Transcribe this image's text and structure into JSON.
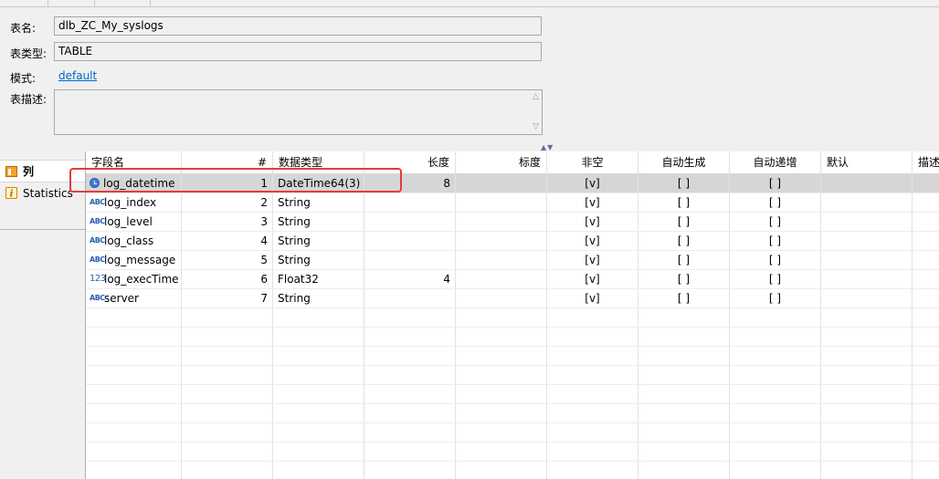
{
  "form": {
    "table_name_label": "表名:",
    "table_name_value": "dlb_ZC_My_syslogs",
    "table_type_label": "表类型:",
    "table_type_value": "TABLE",
    "schema_label": "模式:",
    "schema_value": "default",
    "description_label": "表描述:",
    "description_value": ""
  },
  "side_tabs": [
    {
      "label": "列",
      "icon": "columns-icon",
      "active": true
    },
    {
      "label": "Statistics",
      "icon": "info-icon",
      "active": false
    }
  ],
  "columns_table": {
    "headers": [
      "字段名",
      "#",
      "数据类型",
      "长度",
      "标度",
      "非空",
      "自动生成",
      "自动递增",
      "默认",
      "描述"
    ],
    "rows": [
      {
        "name": "log_datetime",
        "icon": "datetime-icon",
        "index": "1",
        "type": "DateTime64(3)",
        "length": "8",
        "scale": "",
        "not_null": "[v]",
        "auto_gen": "[ ]",
        "auto_inc": "[ ]",
        "default": "",
        "description": "",
        "selected": true
      },
      {
        "name": "log_index",
        "icon": "string-icon",
        "index": "2",
        "type": "String",
        "length": "",
        "scale": "",
        "not_null": "[v]",
        "auto_gen": "[ ]",
        "auto_inc": "[ ]",
        "default": "",
        "description": ""
      },
      {
        "name": "log_level",
        "icon": "string-icon",
        "index": "3",
        "type": "String",
        "length": "",
        "scale": "",
        "not_null": "[v]",
        "auto_gen": "[ ]",
        "auto_inc": "[ ]",
        "default": "",
        "description": ""
      },
      {
        "name": "log_class",
        "icon": "string-icon",
        "index": "4",
        "type": "String",
        "length": "",
        "scale": "",
        "not_null": "[v]",
        "auto_gen": "[ ]",
        "auto_inc": "[ ]",
        "default": "",
        "description": ""
      },
      {
        "name": "log_message",
        "icon": "string-icon",
        "index": "5",
        "type": "String",
        "length": "",
        "scale": "",
        "not_null": "[v]",
        "auto_gen": "[ ]",
        "auto_inc": "[ ]",
        "default": "",
        "description": ""
      },
      {
        "name": "log_execTime",
        "icon": "number-icon",
        "index": "6",
        "type": "Float32",
        "length": "4",
        "scale": "",
        "not_null": "[v]",
        "auto_gen": "[ ]",
        "auto_inc": "[ ]",
        "default": "",
        "description": ""
      },
      {
        "name": "server",
        "icon": "string-icon",
        "index": "7",
        "type": "String",
        "length": "",
        "scale": "",
        "not_null": "[v]",
        "auto_gen": "[ ]",
        "auto_inc": "[ ]",
        "default": "",
        "description": ""
      }
    ]
  },
  "icons": {
    "string_glyph": "ABC",
    "number_glyph": "123"
  },
  "colors": {
    "highlight_box": "#e23c3c",
    "link": "#0066cc",
    "selected_row": "#d6d6d6"
  }
}
